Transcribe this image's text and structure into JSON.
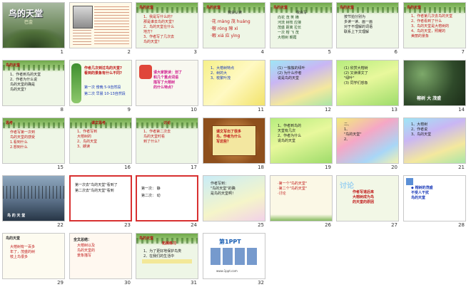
{
  "window": {
    "title": "鸟的天堂"
  },
  "slides": [
    {
      "n": "1",
      "title": "鸟的天堂",
      "sub": "巴金"
    },
    {
      "n": "2",
      "text": ""
    },
    {
      "n": "3",
      "tag": "鸟的天堂",
      "text": "1、我是写什么的？\n那是谁去鸟的天堂？\n2、鸟的天堂在什么\n地方？\n3、作者写了几次去\n鸟的天堂？"
    },
    {
      "n": "4",
      "tag": "鸟的天堂",
      "head": "我会认读",
      "text": "·花  màng  茂 huáng\n·榕  róng  隙 xì\n·暇  xiá   应 yìng"
    },
    {
      "n": "5",
      "tag": "鸟的天堂",
      "head": "我会写",
      "text": "向花  茂 笑  横\n河流  树枝  应接\n茂盛  距离  拉长\n一次  榕 飞 茂\n大榕树  朝霞"
    },
    {
      "n": "6",
      "tag": "鸟的天堂",
      "text": "按节拍分别为\n多读一读、画一画\n对于不理解的词语\n联系上下文理解"
    },
    {
      "n": "7",
      "tag": "鸟的天堂",
      "text": "1、作者第几次去鸟的天堂\n2、作者看到了什么\n3、鸟的天堂是大榕树的\n4、鸟的天堂，照耀的\n   美丽的景象"
    },
    {
      "n": "8",
      "tag": "鸟的天堂",
      "text": "1、作者到鸟的天堂\n2、作者为什么说\n   鸟的天堂的确是\n   鸟的天堂？"
    },
    {
      "n": "9",
      "head": "作者几次到过鸟的天堂?\n看到的景象有什么不同?",
      "text": "第一次 傍晚  5-9自然段\n第二次 早晨  10-13自然段"
    },
    {
      "n": "10",
      "text": "请大家默读：划了\n和几个重点词语\n描写了大榕树\n的什么特点？"
    },
    {
      "n": "11",
      "text": "1、大榕树特点\n2、树的大\n3、枝繁叶茂"
    },
    {
      "n": "12",
      "text": "(1) 一簇簇的绿叶\n(2) 为什么作者\n     说是鸟的天堂"
    },
    {
      "n": "13",
      "text": "(1) 欣赏大榕树\n(2) 又读课文了\n     \"绿叶\"\n(3) 同学们想象"
    },
    {
      "n": "14",
      "text": "榕树  大  茂盛"
    },
    {
      "n": "15",
      "tag": "思考",
      "text": "作者写第一次到\n鸟的天堂的感受\n1.看到什么\n2.想到什么"
    },
    {
      "n": "16",
      "tag": "课文思考",
      "text": "1、作者写到\n   大榕树的\n2、鸟的天堂\n3、朗读"
    },
    {
      "n": "17",
      "tag": "讨论",
      "text": "1、作者第二次去\n   鸟的天堂时看\n   到了什么？"
    },
    {
      "n": "18",
      "text": "课文写出了很多\n鸟，作者为什么\n写这些？"
    },
    {
      "n": "19",
      "text": "1、作者到鸟的\n   天堂有几次\n2、作者为什么\n   说鸟的天堂"
    },
    {
      "n": "20",
      "text": "二、\n1、\n\"鸟的天堂\"\n2、"
    },
    {
      "n": "21",
      "text": "1、大榕树\n2、作者说\n3、鸟的天堂"
    },
    {
      "n": "22",
      "text": "鸟 的 天 堂"
    },
    {
      "n": "23",
      "text": "第一次去\"鸟的天堂\"看到了\n第二次去\"鸟的天堂\"看到"
    },
    {
      "n": "24",
      "text": "第一次：  静\n第二次：  动"
    },
    {
      "n": "25",
      "text": "作者写到：\n\"鸟的天堂\"的确\n是鸟的天堂啊！"
    },
    {
      "n": "26",
      "text": "·第一个\"鸟的天堂\"\n·第二个\"鸟的天堂\"\n·讨论"
    },
    {
      "n": "27",
      "head": "讨论",
      "text": "作者写道后来\n大榕树成为鸟\n的天堂的原因"
    },
    {
      "n": "28",
      "text": "◆ 榕树的茂盛\n  不受人干扰\n  鸟的天堂"
    },
    {
      "n": "29",
      "tag": "鸟的天堂",
      "text": "大榕树有一百多\n年了，茂盛的树\n枝上鸟很多"
    },
    {
      "n": "30",
      "head": "全文总结：",
      "text": "大榕树以及\n鸟的天堂的\n景象描写"
    },
    {
      "n": "31",
      "tag": "鸟的天堂",
      "head": "拓展练习",
      "text": "1、为了更好地保护鸟类\n2、在我们的生活中"
    },
    {
      "n": "32",
      "head": "第1PPT",
      "text": "www.1ppt.com"
    }
  ]
}
